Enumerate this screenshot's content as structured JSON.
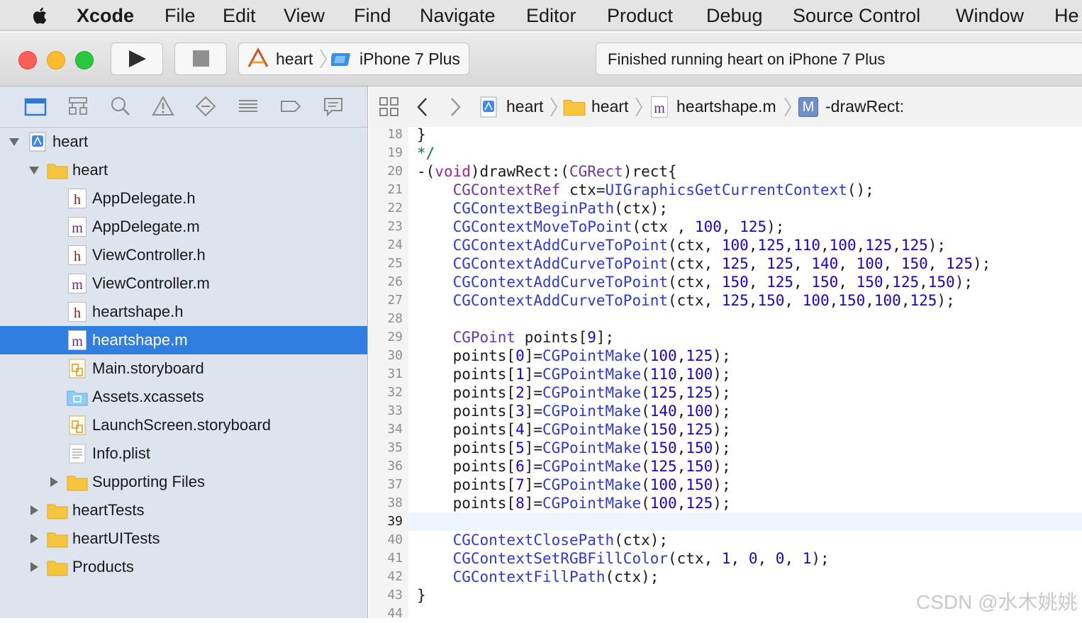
{
  "menubar": {
    "items": [
      "Xcode",
      "File",
      "Edit",
      "View",
      "Find",
      "Navigate",
      "Editor",
      "Product",
      "Debug",
      "Source Control",
      "Window",
      "He"
    ]
  },
  "toolbar": {
    "scheme_target": "heart",
    "scheme_device": "iPhone 7 Plus",
    "activity_status": "Finished running heart on iPhone 7 Plus"
  },
  "navigator": {
    "items": [
      {
        "label": "heart",
        "kind": "project",
        "disclosure": "expanded"
      },
      {
        "label": "heart",
        "kind": "folder",
        "disclosure": "expanded"
      },
      {
        "label": "AppDelegate.h",
        "kind": "h-file"
      },
      {
        "label": "AppDelegate.m",
        "kind": "m-file"
      },
      {
        "label": "ViewController.h",
        "kind": "h-file"
      },
      {
        "label": "ViewController.m",
        "kind": "m-file"
      },
      {
        "label": "heartshape.h",
        "kind": "h-file"
      },
      {
        "label": "heartshape.m",
        "kind": "m-file",
        "selected": true
      },
      {
        "label": "Main.storyboard",
        "kind": "storyboard"
      },
      {
        "label": "Assets.xcassets",
        "kind": "assets"
      },
      {
        "label": "LaunchScreen.storyboard",
        "kind": "storyboard"
      },
      {
        "label": "Info.plist",
        "kind": "plist"
      },
      {
        "label": "Supporting Files",
        "kind": "folder",
        "disclosure": "collapsed"
      },
      {
        "label": "heartTests",
        "kind": "folder",
        "disclosure": "collapsed"
      },
      {
        "label": "heartUITests",
        "kind": "folder",
        "disclosure": "collapsed"
      },
      {
        "label": "Products",
        "kind": "folder",
        "disclosure": "collapsed"
      }
    ]
  },
  "jumpbar": {
    "crumbs": [
      "heart",
      "heart",
      "heartshape.m",
      "-drawRect:"
    ],
    "method_badge": "M"
  },
  "editor": {
    "current_line": "39",
    "line_numbers": [
      "18",
      "19",
      "20",
      "21",
      "22",
      "23",
      "24",
      "25",
      "26",
      "27",
      "28",
      "29",
      "30",
      "31",
      "32",
      "33",
      "34",
      "35",
      "36",
      "37",
      "38",
      "39",
      "40",
      "41",
      "42",
      "43",
      "44"
    ],
    "code_lines": [
      "}",
      "*/",
      "-(void)drawRect:(CGRect)rect{",
      "    CGContextRef ctx=UIGraphicsGetCurrentContext();",
      "    CGContextBeginPath(ctx);",
      "    CGContextMoveToPoint(ctx , 100, 125);",
      "    CGContextAddCurveToPoint(ctx, 100,125,110,100,125,125);",
      "    CGContextAddCurveToPoint(ctx, 125, 125, 140, 100, 150, 125);",
      "    CGContextAddCurveToPoint(ctx, 150, 125, 150, 150,125,150);",
      "    CGContextAddCurveToPoint(ctx, 125,150, 100,150,100,125);",
      "",
      "    CGPoint points[9];",
      "    points[0]=CGPointMake(100,125);",
      "    points[1]=CGPointMake(110,100);",
      "    points[2]=CGPointMake(125,125);",
      "    points[3]=CGPointMake(140,100);",
      "    points[4]=CGPointMake(150,125);",
      "    points[5]=CGPointMake(150,150);",
      "    points[6]=CGPointMake(125,150);",
      "    points[7]=CGPointMake(100,150);",
      "    points[8]=CGPointMake(100,125);",
      "",
      "    CGContextClosePath(ctx);",
      "    CGContextSetRGBFillColor(ctx, 1, 0, 0, 1);",
      "    CGContextFillPath(ctx);",
      "}",
      ""
    ]
  },
  "watermark": "CSDN @水木姚姚",
  "colors": {
    "selection": "#2f7ee0",
    "function": "#2e3ad1",
    "type": "#6b36a8",
    "keyword": "#a0239f",
    "number": "#1c00cf",
    "comment": "#0f7a33"
  }
}
